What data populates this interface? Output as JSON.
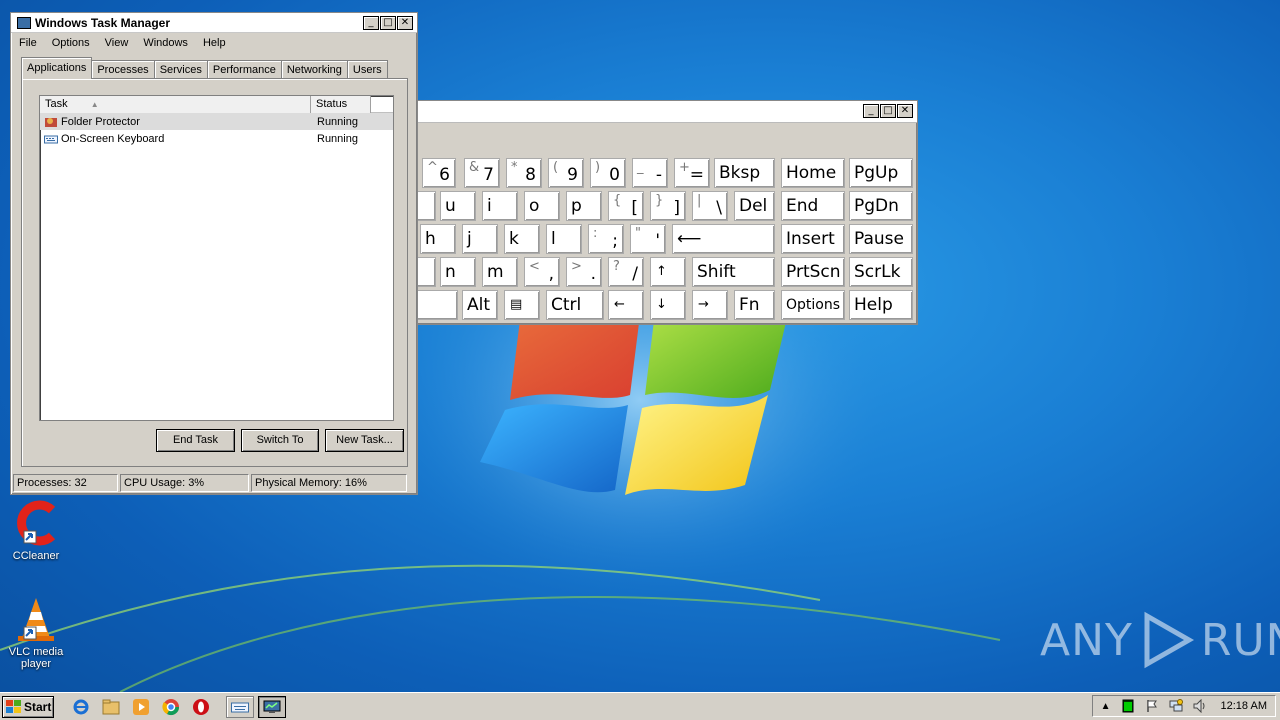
{
  "taskmgr": {
    "title": "Windows Task Manager",
    "menu": [
      "File",
      "Options",
      "View",
      "Windows",
      "Help"
    ],
    "tabs": [
      "Applications",
      "Processes",
      "Services",
      "Performance",
      "Networking",
      "Users"
    ],
    "active_tab": "Applications",
    "columns": {
      "task": "Task",
      "status": "Status"
    },
    "rows": [
      {
        "task": "Folder Protector",
        "status": "Running",
        "icon": "folder-protector-icon"
      },
      {
        "task": "On-Screen Keyboard",
        "status": "Running",
        "icon": "keyboard-icon"
      }
    ],
    "buttons": {
      "end_task": "End Task",
      "switch_to": "Switch To",
      "new_task": "New Task..."
    },
    "status": {
      "processes": "Processes: 32",
      "cpu": "CPU Usage: 3%",
      "memory": "Physical Memory: 16%"
    }
  },
  "osk": {
    "keys": {
      "k6": {
        "shift": "^",
        "main": "6"
      },
      "k7": {
        "shift": "&",
        "main": "7"
      },
      "k8": {
        "shift": "*",
        "main": "8"
      },
      "k9": {
        "shift": "(",
        "main": "9"
      },
      "k0": {
        "shift": ")",
        "main": "0"
      },
      "kminus": {
        "shift": "_",
        "main": "-"
      },
      "kequal": {
        "shift": "+",
        "main": "="
      },
      "bksp": "Bksp",
      "home": "Home",
      "pgup": "PgUp",
      "u": "u",
      "i": "i",
      "o": "o",
      "p": "p",
      "lbracket": {
        "shift": "{",
        "main": "["
      },
      "rbracket": {
        "shift": "}",
        "main": "]"
      },
      "backslash": {
        "shift": "|",
        "main": "\\"
      },
      "del": "Del",
      "end": "End",
      "pgdn": "PgDn",
      "h": "h",
      "j": "j",
      "k": "k",
      "l": "l",
      "semicolon": {
        "shift": ":",
        "main": ";"
      },
      "quote": {
        "shift": "\"",
        "main": "'"
      },
      "enter": "⟵",
      "insert": "Insert",
      "pause": "Pause",
      "n": "n",
      "m": "m",
      "comma": {
        "shift": "<",
        "main": ","
      },
      "period": {
        "shift": ">",
        "main": "."
      },
      "slash": {
        "shift": "?",
        "main": "/"
      },
      "up": "↑",
      "shift": "Shift",
      "prtscn": "PrtScn",
      "scrlk": "ScrLk",
      "alt": "Alt",
      "menu": "▤",
      "ctrl": "Ctrl",
      "left": "←",
      "down": "↓",
      "right": "→",
      "fn": "Fn",
      "options": "Options",
      "help": "Help"
    }
  },
  "desktop": {
    "icons": [
      {
        "label": "CCleaner"
      },
      {
        "label": "VLC media player"
      }
    ]
  },
  "taskbar": {
    "start": "Start",
    "clock": "12:18 AM"
  },
  "watermark": {
    "left": "ANY",
    "right": "RUN"
  },
  "colors": {
    "desktop": "#1a7fd4",
    "chrome": "#d4d0c8",
    "selection": "#dcdcdc"
  }
}
